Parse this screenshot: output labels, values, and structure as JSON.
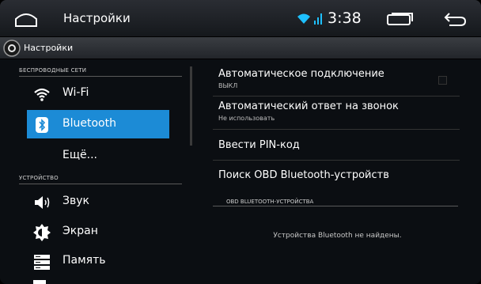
{
  "statusbar": {
    "title": "Настройки",
    "time": "3:38",
    "icons": [
      "home-icon",
      "wifi-icon",
      "signal-icon",
      "recent-apps-icon",
      "back-icon"
    ],
    "accent": "#1c8bd6"
  },
  "actionbar": {
    "title": "Настройки",
    "icon": "settings-app-icon"
  },
  "sidebar": {
    "section_wireless": "БЕСПРОВОДНЫЕ СЕТИ",
    "section_device": "УСТРОЙСТВО",
    "items": [
      {
        "label": "Wi-Fi",
        "icon": "wifi-icon"
      },
      {
        "label": "Bluetooth",
        "icon": "bluetooth-icon",
        "active": true
      },
      {
        "label": "Ещё...",
        "icon": ""
      },
      {
        "label": "Звук",
        "icon": "speaker-icon"
      },
      {
        "label": "Экран",
        "icon": "brightness-icon"
      },
      {
        "label": "Память",
        "icon": "storage-icon"
      }
    ]
  },
  "main": {
    "prefs": [
      {
        "title": "Автоматическое подключение",
        "summary": "ВЫКЛ"
      },
      {
        "title": "Автоматический ответ на звонок",
        "summary": "Не использовать"
      },
      {
        "title": "Ввести PIN-код",
        "summary": ""
      },
      {
        "title": "Поиск OBD Bluetooth-устройств",
        "summary": ""
      }
    ],
    "obd_header": "OBD BLUETOOTH-УСТРОЙСТВА",
    "empty_message": "Устройства Bluetooth не найдены."
  }
}
